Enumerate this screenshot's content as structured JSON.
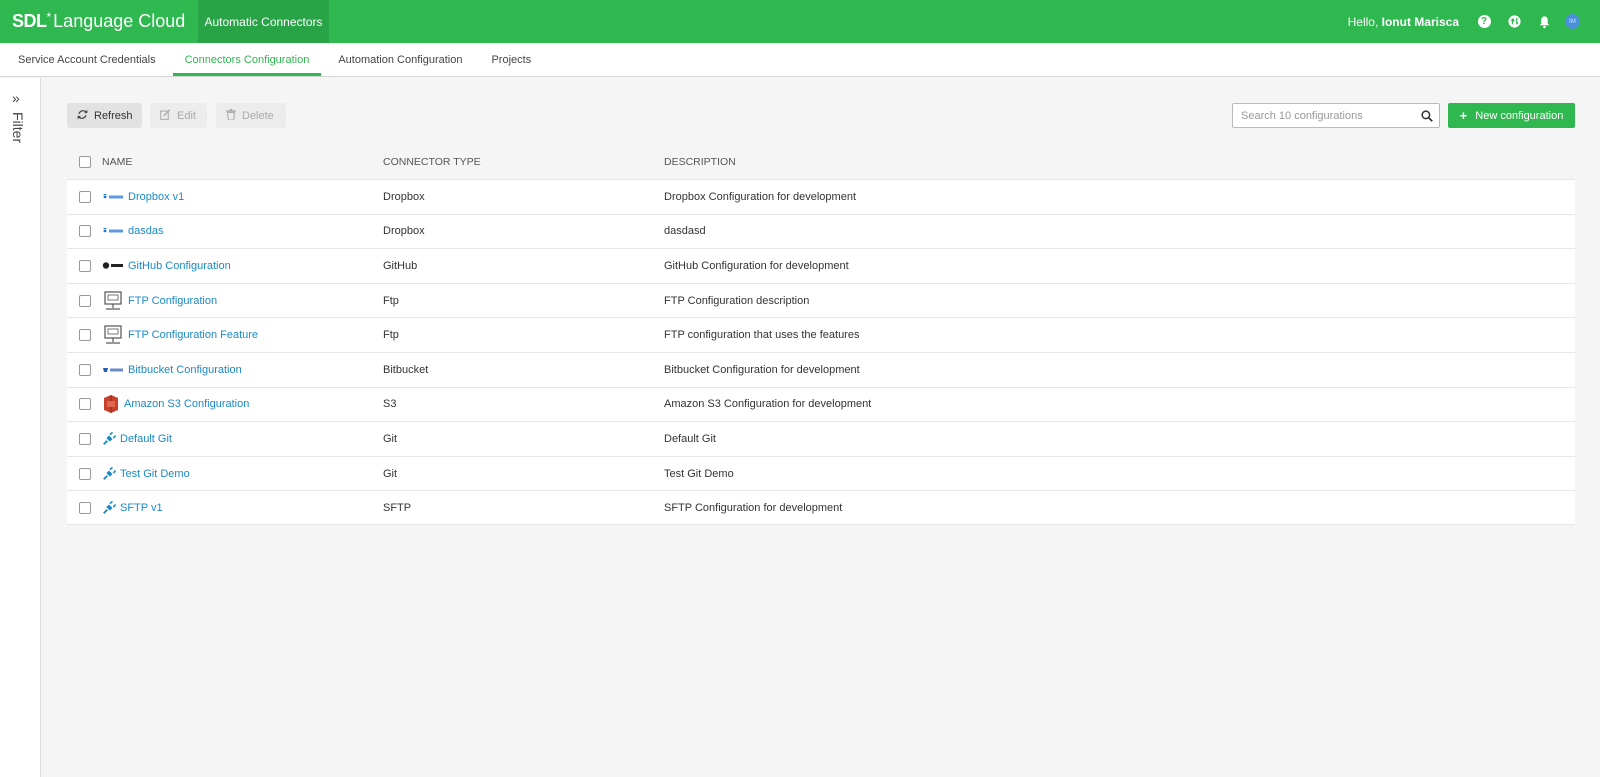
{
  "header": {
    "brand_sdl": "SDL",
    "brand_star": "*",
    "brand_product": "Language Cloud",
    "app_tab": "Automatic Connectors",
    "greeting_prefix": "Hello,",
    "user_name": "Ionut Marisca",
    "avatar_initials": "IM"
  },
  "nav": {
    "tabs": [
      {
        "label": "Service Account Credentials",
        "active": false
      },
      {
        "label": "Connectors Configuration",
        "active": true
      },
      {
        "label": "Automation Configuration",
        "active": false
      },
      {
        "label": "Projects",
        "active": false
      }
    ]
  },
  "filter": {
    "label": "Filter"
  },
  "toolbar": {
    "refresh_label": "Refresh",
    "edit_label": "Edit",
    "delete_label": "Delete",
    "search_placeholder": "Search 10 configurations",
    "new_label": "New configuration"
  },
  "table": {
    "headers": {
      "name": "NAME",
      "type": "CONNECTOR TYPE",
      "description": "DESCRIPTION"
    },
    "rows": [
      {
        "name": "Dropbox v1",
        "type": "Dropbox",
        "description": "Dropbox Configuration for development",
        "icon": "dropbox-icon"
      },
      {
        "name": "dasdas",
        "type": "Dropbox",
        "description": "dasdasd",
        "icon": "dropbox-icon"
      },
      {
        "name": "GitHub Configuration",
        "type": "GitHub",
        "description": "GitHub Configuration for development",
        "icon": "github-icon"
      },
      {
        "name": "FTP Configuration",
        "type": "Ftp",
        "description": "FTP Configuration description",
        "icon": "ftp-icon"
      },
      {
        "name": "FTP Configuration Feature",
        "type": "Ftp",
        "description": "FTP configuration that uses the features",
        "icon": "ftp-icon"
      },
      {
        "name": "Bitbucket Configuration",
        "type": "Bitbucket",
        "description": "Bitbucket Configuration for development",
        "icon": "bitbucket-icon"
      },
      {
        "name": "Amazon S3 Configuration",
        "type": "S3",
        "description": "Amazon S3 Configuration for development",
        "icon": "amazon-s3-icon"
      },
      {
        "name": "Default Git",
        "type": "Git",
        "description": "Default Git",
        "icon": "plug-icon"
      },
      {
        "name": "Test Git Demo",
        "type": "Git",
        "description": "Test Git Demo",
        "icon": "plug-icon"
      },
      {
        "name": "SFTP v1",
        "type": "SFTP",
        "description": "SFTP Configuration for development",
        "icon": "plug-icon"
      }
    ]
  },
  "colors": {
    "brand_green": "#2eb84f",
    "link_blue": "#1a8ac6"
  }
}
